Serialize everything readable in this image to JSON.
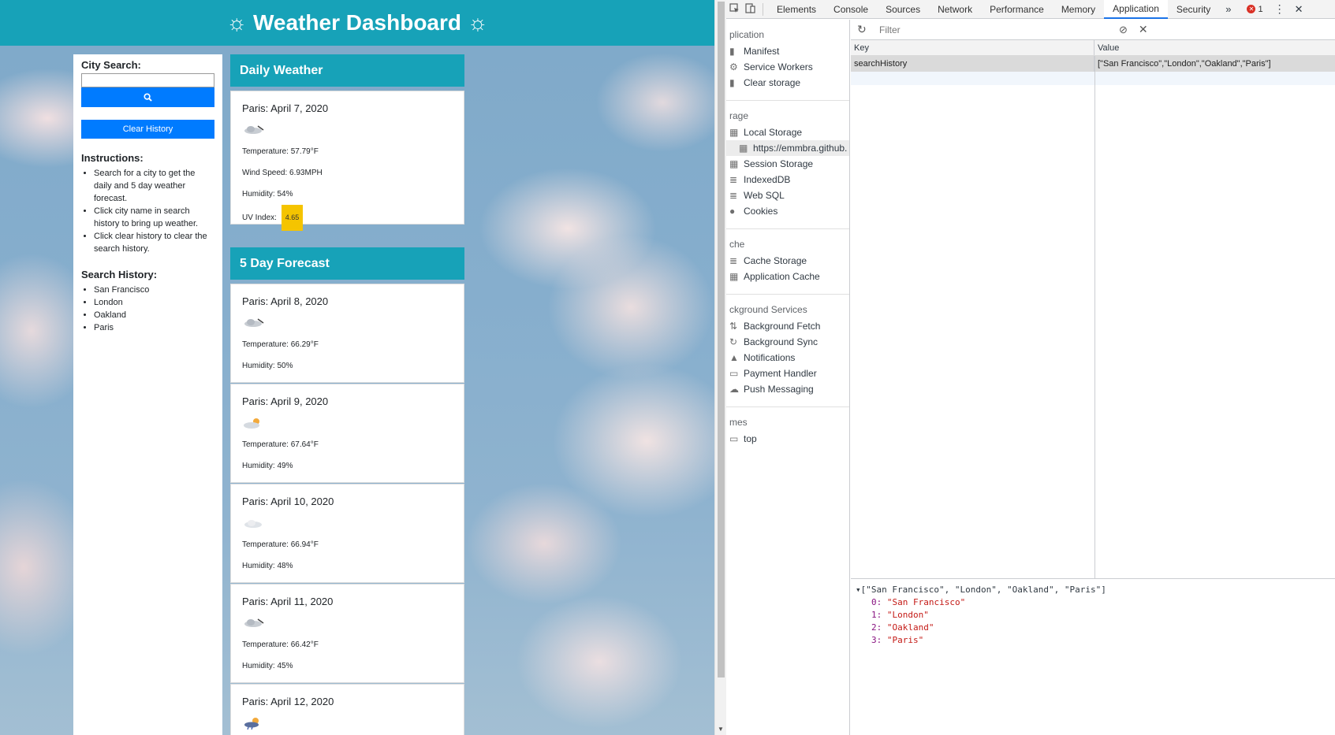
{
  "app": {
    "title": "Weather Dashboard",
    "sun_glyph": "☼"
  },
  "sidebar": {
    "city_label": "City Search:",
    "city_value": "",
    "search_icon": "search-icon",
    "clear_label": "Clear History",
    "instructions_title": "Instructions:",
    "instructions": [
      "Search for a city to get the daily and 5 day weather forecast.",
      "Click city name in search history to bring up weather.",
      "Click clear history to clear the search history."
    ],
    "history_title": "Search History:",
    "history": [
      "San Francisco",
      "London",
      "Oakland",
      "Paris"
    ]
  },
  "daily": {
    "header": "Daily Weather",
    "date": "Paris: April 7, 2020",
    "icon": "rain-cloud-icon",
    "temperature": "Temperature: 57.79°F",
    "wind": "Wind Speed: 6.93MPH",
    "humidity": "Humidity: 54%",
    "uv_label": "UV Index:",
    "uv_value": "4.65",
    "uv_color": "#f5c400"
  },
  "forecast": {
    "header": "5 Day Forecast",
    "days": [
      {
        "date": "Paris: April 8, 2020",
        "icon": "rain-cloud-icon",
        "temperature": "Temperature: 66.29°F",
        "humidity": "Humidity: 50%"
      },
      {
        "date": "Paris: April 9, 2020",
        "icon": "partly-sunny-icon",
        "temperature": "Temperature: 67.64°F",
        "humidity": "Humidity: 49%"
      },
      {
        "date": "Paris: April 10, 2020",
        "icon": "cloud-icon",
        "temperature": "Temperature: 66.94°F",
        "humidity": "Humidity: 48%"
      },
      {
        "date": "Paris: April 11, 2020",
        "icon": "rain-cloud-icon",
        "temperature": "Temperature: 66.42°F",
        "humidity": "Humidity: 45%"
      },
      {
        "date": "Paris: April 12, 2020",
        "icon": "sun-rain-icon"
      }
    ]
  },
  "devtools": {
    "tabs": [
      "Elements",
      "Console",
      "Sources",
      "Network",
      "Performance",
      "Memory",
      "Application",
      "Security"
    ],
    "active_tab": "Application",
    "error_count": "1",
    "sidebar": {
      "application_section": "plication",
      "application_items": [
        "Manifest",
        "Service Workers",
        "Clear storage"
      ],
      "storage_section": "rage",
      "local_storage": "Local Storage",
      "local_storage_origin": "https://emmbra.github.",
      "storage_items": [
        "Session Storage",
        "IndexedDB",
        "Web SQL",
        "Cookies"
      ],
      "cache_section": "che",
      "cache_items": [
        "Cache Storage",
        "Application Cache"
      ],
      "bg_section": "ckground Services",
      "bg_items": [
        "Background Fetch",
        "Background Sync",
        "Notifications",
        "Payment Handler",
        "Push Messaging"
      ],
      "frames_section": "mes",
      "frames_items": [
        "top"
      ]
    },
    "filter_placeholder": "Filter",
    "table": {
      "key_header": "Key",
      "value_header": "Value",
      "rows": [
        {
          "key": "searchHistory",
          "value": "[\"San Francisco\",\"London\",\"Oakland\",\"Paris\"]"
        }
      ]
    },
    "preview": {
      "summary": "[\"San Francisco\", \"London\", \"Oakland\", \"Paris\"]",
      "entries": [
        {
          "index": "0:",
          "value": "\"San Francisco\""
        },
        {
          "index": "1:",
          "value": "\"London\""
        },
        {
          "index": "2:",
          "value": "\"Oakland\""
        },
        {
          "index": "3:",
          "value": "\"Paris\""
        }
      ]
    }
  }
}
